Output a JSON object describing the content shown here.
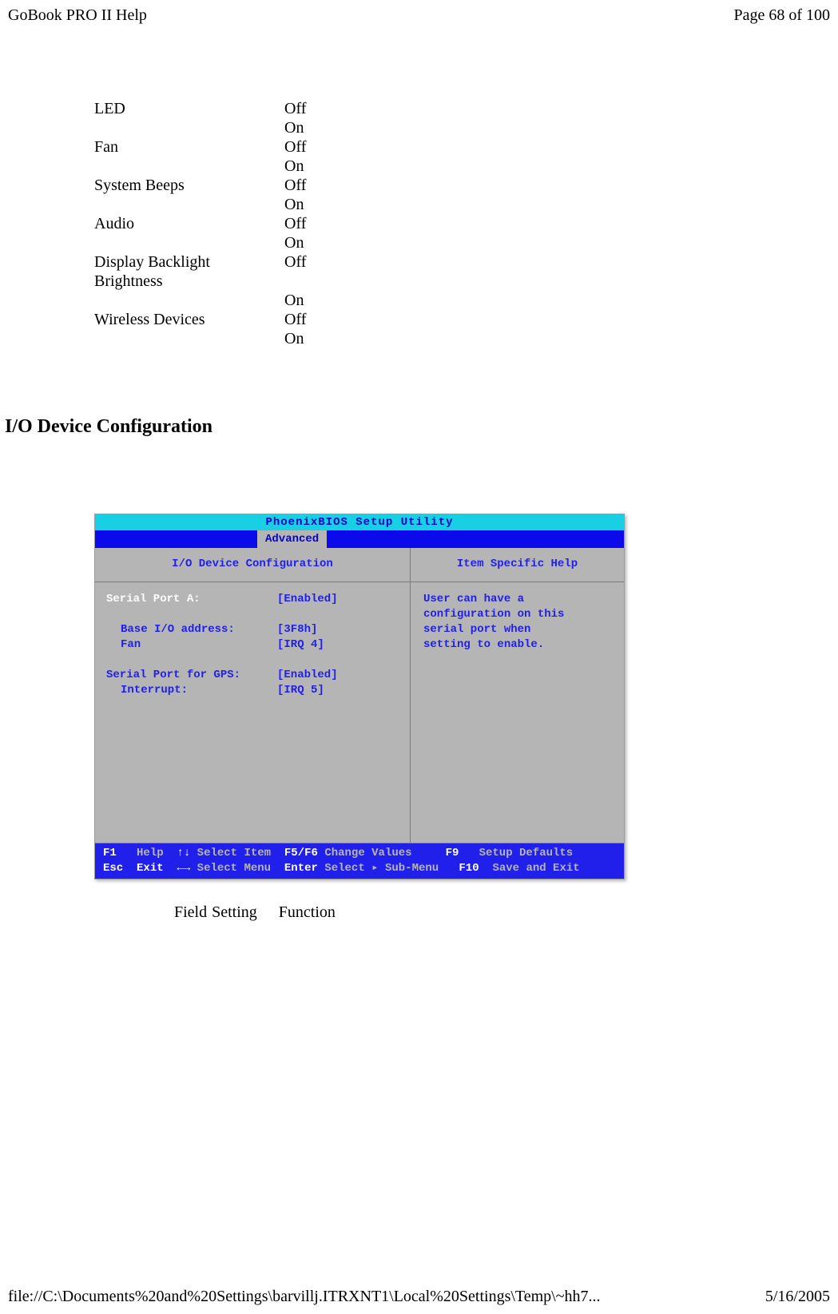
{
  "header": {
    "title": "GoBook PRO II Help",
    "page": "Page 68 of 100"
  },
  "settings": [
    {
      "label": "LED",
      "v1": "Off",
      "v2": "On"
    },
    {
      "label": "Fan",
      "v1": "Off",
      "v2": "On"
    },
    {
      "label": "System Beeps",
      "v1": "Off",
      "v2": "On"
    },
    {
      "label": "Audio",
      "v1": "Off",
      "v2": "On"
    },
    {
      "label": "Display Backlight Brightness",
      "v1": "Off",
      "v2": "On"
    },
    {
      "label": "Wireless Devices",
      "v1": "Off",
      "v2": "On"
    }
  ],
  "section_title": "I/O Device Configuration",
  "bios": {
    "title": "PhoenixBIOS  Setup  Utility",
    "active_tab": "Advanced",
    "left_title": "I/O  Device  Configuration",
    "right_title": "Item  Specific  Help",
    "fields": {
      "serial_a_label": "Serial Port A:",
      "serial_a_value": "[Enabled]",
      "base_io_label": "Base I/O address:",
      "base_io_value": "[3F8h]",
      "fan_label": "Fan",
      "fan_value": "[IRQ 4]",
      "serial_gps_label": "Serial Port for GPS:",
      "serial_gps_value": "[Enabled]",
      "interrupt_label": "Interrupt:",
      "interrupt_value": "[IRQ 5]"
    },
    "help_text": {
      "l1": "User can have a",
      "l2": "configuration on  this",
      "l3": "serial port  when",
      "l4": "setting to enable."
    },
    "footer": {
      "f1": "F1",
      "f1_label": "Help",
      "arrows_ud": "↑↓",
      "select_item": "Select Item",
      "f5f6": "F5/F6",
      "change_values": "Change Values",
      "f9": "F9",
      "setup_defaults": "Setup Defaults",
      "esc": "Esc",
      "exit": "Exit",
      "arrows_lr": "←→",
      "select_menu": "Select Menu",
      "enter": "Enter",
      "select_sub": "Select ▸ Sub-Menu",
      "f10": "F10",
      "save_exit": "Save and Exit"
    }
  },
  "field_headers": {
    "c1": "Field",
    "c2": "Setting",
    "c3": "Function"
  },
  "footer": {
    "path": "file://C:\\Documents%20and%20Settings\\barvillj.ITRXNT1\\Local%20Settings\\Temp\\~hh7...",
    "date": "5/16/2005"
  }
}
